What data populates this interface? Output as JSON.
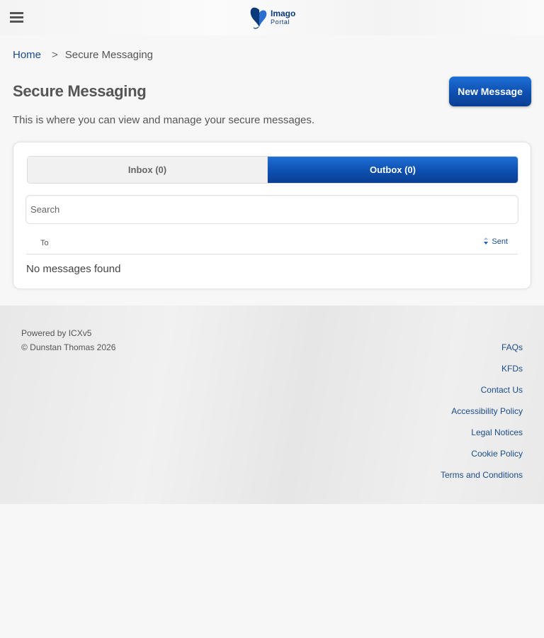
{
  "header": {
    "menu_icon": "hamburger-icon",
    "logo_icon": "butterfly-logo-icon",
    "logo_title": "Imago",
    "logo_subtitle": "Portal"
  },
  "breadcrumb": {
    "home": "Home",
    "separator": ">",
    "current": "Secure Messaging"
  },
  "page": {
    "title": "Secure Messaging",
    "new_message_label": "New Message",
    "description": "This is where you can view and manage your secure messages."
  },
  "tabs": [
    {
      "label": "Inbox (0)",
      "active": false
    },
    {
      "label": "Outbox (0)",
      "active": true
    }
  ],
  "search": {
    "placeholder": "Search",
    "value": ""
  },
  "table": {
    "columns": [
      "To",
      "Sent"
    ],
    "sort_icon": "sort-desc-icon",
    "empty_message": "No messages found"
  },
  "footer": {
    "powered_by": "Powered by ICXv5",
    "copyright": "© Dunstan Thomas 2026",
    "links": [
      "FAQs",
      "KFDs",
      "Contact Us",
      "Accessibility Policy",
      "Legal Notices",
      "Cookie Policy",
      "Terms and Conditions"
    ]
  },
  "colors": {
    "primary": "#0d4fb0",
    "link": "#1b4c8a",
    "text": "#555555",
    "background": "#f7f7f7"
  }
}
